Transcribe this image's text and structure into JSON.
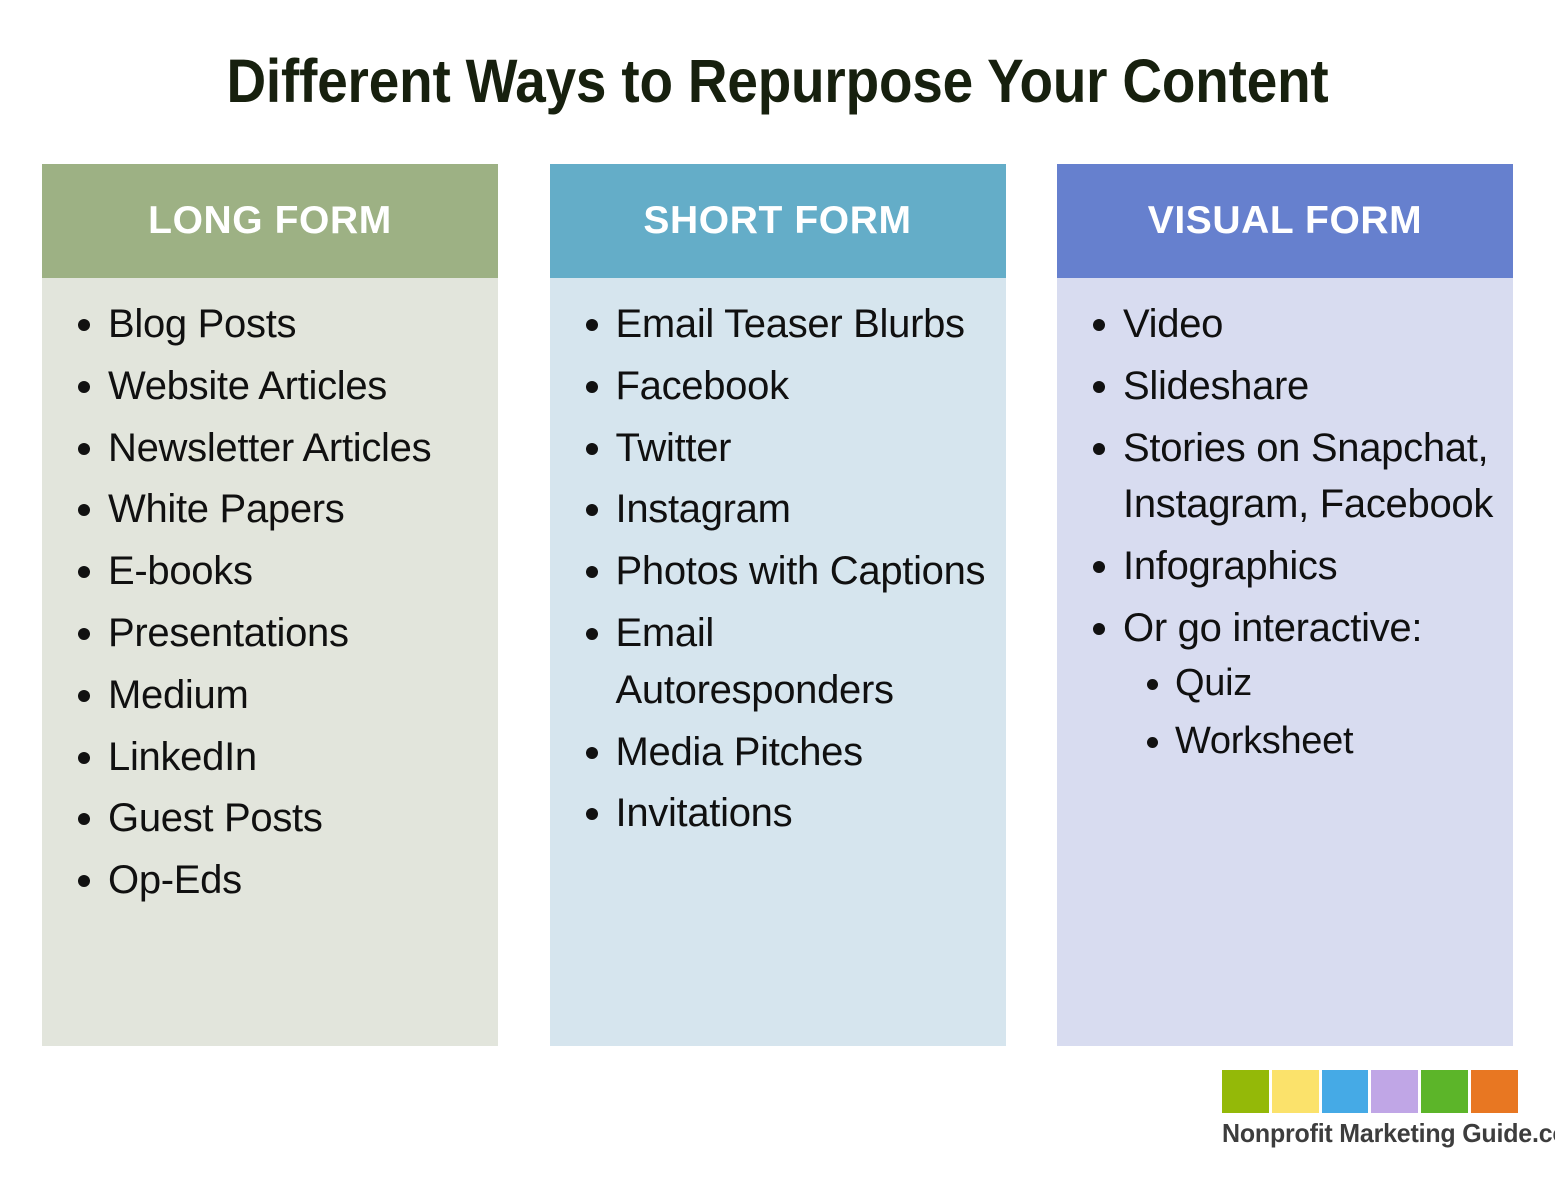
{
  "title": "Different Ways to Repurpose Your Content",
  "columns": [
    {
      "header": "LONG FORM",
      "header_color": "#9DB184",
      "body_color": "#E2E5DC",
      "items": [
        {
          "label": "Blog Posts"
        },
        {
          "label": "Website Articles"
        },
        {
          "label": "Newsletter Articles"
        },
        {
          "label": "White Papers"
        },
        {
          "label": "E-books"
        },
        {
          "label": "Presentations"
        },
        {
          "label": "Medium"
        },
        {
          "label": "LinkedIn"
        },
        {
          "label": "Guest Posts"
        },
        {
          "label": "Op-Eds"
        }
      ]
    },
    {
      "header": "SHORT FORM",
      "header_color": "#64ADC8",
      "body_color": "#D6E5EE",
      "items": [
        {
          "label": "Email Teaser Blurbs"
        },
        {
          "label": "Facebook"
        },
        {
          "label": "Twitter"
        },
        {
          "label": "Instagram"
        },
        {
          "label": "Photos with Captions"
        },
        {
          "label": "Email Autoresponders"
        },
        {
          "label": "Media Pitches"
        },
        {
          "label": "Invitations"
        }
      ]
    },
    {
      "header": "VISUAL FORM",
      "header_color": "#6680CE",
      "body_color": "#D8DCF0",
      "items": [
        {
          "label": "Video"
        },
        {
          "label": "Slideshare"
        },
        {
          "label": "Stories on Snapchat, Instagram, Facebook"
        },
        {
          "label": "Infographics"
        },
        {
          "label": "Or go interactive:",
          "subitems": [
            "Quiz",
            "Worksheet"
          ]
        }
      ]
    }
  ],
  "logo": {
    "text": "Nonprofit Marketing Guide.com",
    "swatch_colors": [
      "#94B908",
      "#FBE26B",
      "#45AAE6",
      "#C0A6E6",
      "#5CB529",
      "#E87722"
    ]
  }
}
